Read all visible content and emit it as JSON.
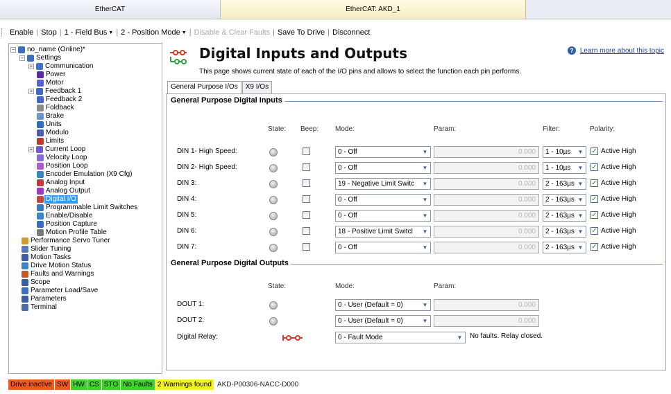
{
  "window": {
    "left_title": "EtherCAT",
    "right_title": "EtherCAT: AKD_1"
  },
  "toolbar": {
    "enable": "Enable",
    "stop": "Stop",
    "field_bus": "1 - Field Bus",
    "position_mode": "2 - Position Mode",
    "disable_clear": "Disable & Clear Faults",
    "save_to_drive": "Save To Drive",
    "disconnect": "Disconnect",
    "separator": "|"
  },
  "tree": {
    "nodes": [
      {
        "label": "no_name (Online)*",
        "icon": "drive-icon",
        "color": "#3a6ec1"
      },
      {
        "label": "Settings",
        "icon": "settings-icon",
        "color": "#3a6ec1"
      },
      {
        "label": "Communication",
        "icon": "communication-icon",
        "color": "#3b73c8"
      },
      {
        "label": "Power",
        "icon": "power-icon",
        "color": "#5a2aa3"
      },
      {
        "label": "Motor",
        "icon": "motor-icon",
        "color": "#5662d3"
      },
      {
        "label": "Feedback 1",
        "icon": "feedback-icon",
        "color": "#3f69c2"
      },
      {
        "label": "Feedback 2",
        "icon": "feedback-icon",
        "color": "#3f69c2"
      },
      {
        "label": "Foldback",
        "icon": "foldback-icon",
        "color": "#8c8c8c"
      },
      {
        "label": "Brake",
        "icon": "brake-icon",
        "color": "#6c95c9"
      },
      {
        "label": "Units",
        "icon": "units-icon",
        "color": "#2d6fb8"
      },
      {
        "label": "Modulo",
        "icon": "modulo-icon",
        "color": "#4a5bb8"
      },
      {
        "label": "Limits",
        "icon": "limits-icon",
        "color": "#c0392b"
      },
      {
        "label": "Current Loop",
        "icon": "current-loop-icon",
        "color": "#6c5bd1"
      },
      {
        "label": "Velocity Loop",
        "icon": "velocity-loop-icon",
        "color": "#8a6bd8"
      },
      {
        "label": "Position Loop",
        "icon": "position-loop-icon",
        "color": "#b35ad1"
      },
      {
        "label": "Encoder Emulation (X9 Cfg)",
        "icon": "encoder-icon",
        "color": "#3a86c9"
      },
      {
        "label": "Analog Input",
        "icon": "analog-input-icon",
        "color": "#c23a3a"
      },
      {
        "label": "Analog Output",
        "icon": "analog-output-icon",
        "color": "#9b3ac2"
      },
      {
        "label": "Digital I/O",
        "icon": "digital-io-icon",
        "color": "#c04a3a"
      },
      {
        "label": "Programmable Limit Switches",
        "icon": "pls-icon",
        "color": "#3a7bc1"
      },
      {
        "label": "Enable/Disable",
        "icon": "enable-icon",
        "color": "#3a86c9"
      },
      {
        "label": "Position Capture",
        "icon": "capture-icon",
        "color": "#3a6ec1"
      },
      {
        "label": "Motion Profile Table",
        "icon": "profile-icon",
        "color": "#7a7a7a"
      },
      {
        "label": "Performance Servo Tuner",
        "icon": "tuner-icon",
        "color": "#d19a2a"
      },
      {
        "label": "Slider Tuning",
        "icon": "slider-icon",
        "color": "#5a7ab8"
      },
      {
        "label": "Motion Tasks",
        "icon": "tasks-icon",
        "color": "#3a5fa0"
      },
      {
        "label": "Drive Motion Status",
        "icon": "status-icon",
        "color": "#3a86c9"
      },
      {
        "label": "Faults and Warnings",
        "icon": "faults-icon",
        "color": "#c8572a"
      },
      {
        "label": "Scope",
        "icon": "scope-icon",
        "color": "#3a5fa0"
      },
      {
        "label": "Parameter Load/Save",
        "icon": "save-icon",
        "color": "#3a6ec1"
      },
      {
        "label": "Parameters",
        "icon": "parameters-icon",
        "color": "#3a5fa0"
      },
      {
        "label": "Terminal",
        "icon": "terminal-icon",
        "color": "#4a6aa8"
      }
    ],
    "selected_label": "Digital I/O"
  },
  "page": {
    "title": "Digital Inputs and Outputs",
    "description": "This page shows current state of each of the I/O pins and allows to select the function each pin performs.",
    "help_link": "Learn more about this topic",
    "tabs": [
      "General Purpose I/Os",
      "X9 I/Os"
    ],
    "active_tab": 0
  },
  "inputs": {
    "title": "General Purpose Digital Inputs",
    "headers": {
      "state": "State:",
      "beep": "Beep:",
      "mode": "Mode:",
      "param": "Param:",
      "filter": "Filter:",
      "polarity": "Polarity:"
    },
    "rows": [
      {
        "label": "DIN 1- High Speed:",
        "mode": "0 - Off",
        "param": "0.000",
        "filter": "1 - 10µs",
        "polarity": "Active High"
      },
      {
        "label": "DIN 2- High Speed:",
        "mode": "0 - Off",
        "param": "0.000",
        "filter": "1 - 10µs",
        "polarity": "Active High"
      },
      {
        "label": "DIN 3:",
        "mode": "19 - Negative Limit Switc",
        "param": "0.000",
        "filter": "2 - 163µs",
        "polarity": "Active High"
      },
      {
        "label": "DIN 4:",
        "mode": "0 - Off",
        "param": "0.000",
        "filter": "2 - 163µs",
        "polarity": "Active High"
      },
      {
        "label": "DIN 5:",
        "mode": "0 - Off",
        "param": "0.000",
        "filter": "2 - 163µs",
        "polarity": "Active High"
      },
      {
        "label": "DIN 6:",
        "mode": "18 - Positive Limit Switcl",
        "param": "0.000",
        "filter": "2 - 163µs",
        "polarity": "Active High"
      },
      {
        "label": "DIN 7:",
        "mode": "0 - Off",
        "param": "0.000",
        "filter": "2 - 163µs",
        "polarity": "Active High"
      }
    ]
  },
  "outputs": {
    "title": "General Purpose Digital Outputs",
    "headers": {
      "state": "State:",
      "mode": "Mode:",
      "param": "Param:"
    },
    "rows": [
      {
        "label": "DOUT 1:",
        "mode": "0 - User (Default = 0)",
        "param": "0.000"
      },
      {
        "label": "DOUT 2:",
        "mode": "0 - User (Default = 0)",
        "param": "0.000"
      }
    ],
    "relay": {
      "label": "Digital Relay:",
      "mode": "0 - Fault Mode",
      "status": "No faults. Relay closed."
    }
  },
  "statusbar": {
    "drive": {
      "label": "Drive inactive",
      "color": "#f05a1e"
    },
    "sw": {
      "label": "SW",
      "color": "#f05a1e"
    },
    "hw": {
      "label": "HW",
      "color": "#3fd22b"
    },
    "cs": {
      "label": "CS",
      "color": "#3fd22b"
    },
    "sto": {
      "label": "STO",
      "color": "#3fd22b"
    },
    "faults": {
      "label": "No Faults",
      "color": "#3fd22b"
    },
    "warnings": {
      "label": "2 Warnings found",
      "color": "#f2f22a"
    },
    "model": "AKD-P00306-NACC-D000"
  }
}
